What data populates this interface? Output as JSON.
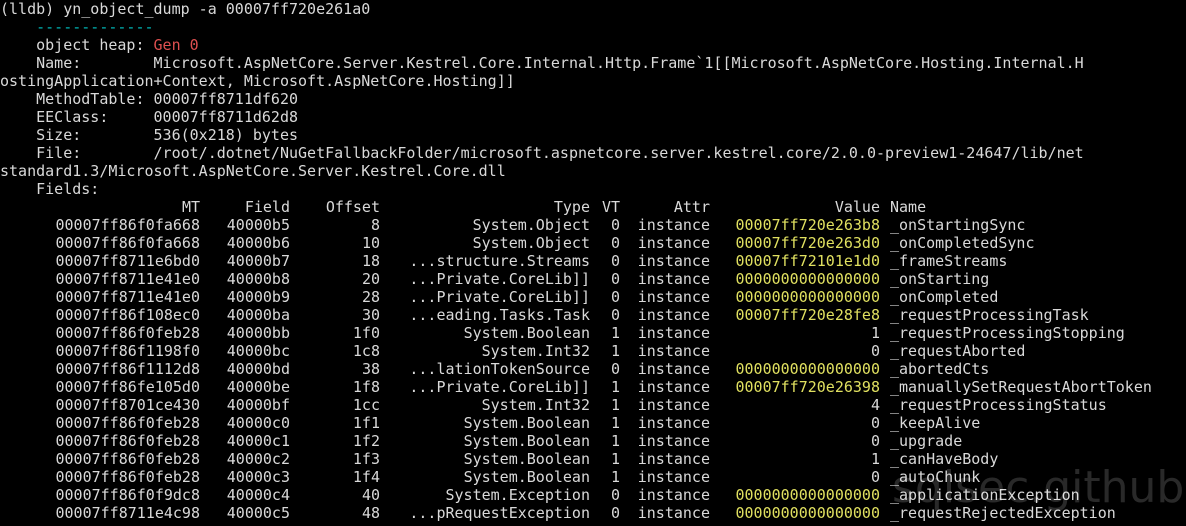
{
  "colors": {
    "background": "#000000",
    "text": "#d9d9d9",
    "separator": "#00b7b7",
    "gen": "#e05050",
    "address_highlight": "#e0e060"
  },
  "command": "(lldb) yn_object_dump -a 00007ff720e261a0",
  "separator": "    -------------",
  "object_heap": {
    "label": "    object heap: ",
    "value": "Gen 0"
  },
  "name_lines": [
    "    Name:        Microsoft.AspNetCore.Server.Kestrel.Core.Internal.Http.Frame`1[[Microsoft.AspNetCore.Hosting.Internal.H",
    "ostingApplication+Context, Microsoft.AspNetCore.Hosting]]"
  ],
  "method_table": "    MethodTable: 00007ff8711df620",
  "ee_class": "    EEClass:     00007ff8711d62d8",
  "size": "    Size:        536(0x218) bytes",
  "file_lines": [
    "    File:        /root/.dotnet/NuGetFallbackFolder/microsoft.aspnetcore.server.kestrel.core/2.0.0-preview1-24647/lib/net",
    "standard1.3/Microsoft.AspNetCore.Server.Kestrel.Core.dll"
  ],
  "fields_label": "    Fields:",
  "columns": {
    "mt": "MT",
    "field": "Field",
    "offset": "Offset",
    "type": "Type",
    "vt": "VT",
    "attr": "Attr",
    "value": "Value",
    "name": "Name"
  },
  "fields": [
    {
      "mt": "00007ff86f0fa668",
      "field": "40000b5",
      "offset": "8",
      "type": "System.Object",
      "vt": "0",
      "attr": "instance",
      "value": "00007ff720e263b8",
      "name": "_onStartingSync",
      "addr": true
    },
    {
      "mt": "00007ff86f0fa668",
      "field": "40000b6",
      "offset": "10",
      "type": "System.Object",
      "vt": "0",
      "attr": "instance",
      "value": "00007ff720e263d0",
      "name": "_onCompletedSync",
      "addr": true
    },
    {
      "mt": "00007ff8711e6bd0",
      "field": "40000b7",
      "offset": "18",
      "type": "...structure.Streams",
      "vt": "0",
      "attr": "instance",
      "value": "00007ff72101e1d0",
      "name": "_frameStreams",
      "addr": true
    },
    {
      "mt": "00007ff8711e41e0",
      "field": "40000b8",
      "offset": "20",
      "type": "...Private.CoreLib]]",
      "vt": "0",
      "attr": "instance",
      "value": "0000000000000000",
      "name": "_onStarting",
      "addr": true
    },
    {
      "mt": "00007ff8711e41e0",
      "field": "40000b9",
      "offset": "28",
      "type": "...Private.CoreLib]]",
      "vt": "0",
      "attr": "instance",
      "value": "0000000000000000",
      "name": "_onCompleted",
      "addr": true
    },
    {
      "mt": "00007ff86f108ec0",
      "field": "40000ba",
      "offset": "30",
      "type": "...eading.Tasks.Task",
      "vt": "0",
      "attr": "instance",
      "value": "00007ff720e28fe8",
      "name": "_requestProcessingTask",
      "addr": true
    },
    {
      "mt": "00007ff86f0feb28",
      "field": "40000bb",
      "offset": "1f0",
      "type": "System.Boolean",
      "vt": "1",
      "attr": "instance",
      "value": "1",
      "name": "_requestProcessingStopping",
      "addr": false
    },
    {
      "mt": "00007ff86f1198f0",
      "field": "40000bc",
      "offset": "1c8",
      "type": "System.Int32",
      "vt": "1",
      "attr": "instance",
      "value": "0",
      "name": "_requestAborted",
      "addr": false
    },
    {
      "mt": "00007ff86f1112d8",
      "field": "40000bd",
      "offset": "38",
      "type": "...lationTokenSource",
      "vt": "0",
      "attr": "instance",
      "value": "0000000000000000",
      "name": "_abortedCts",
      "addr": true
    },
    {
      "mt": "00007ff86fe105d0",
      "field": "40000be",
      "offset": "1f8",
      "type": "...Private.CoreLib]]",
      "vt": "1",
      "attr": "instance",
      "value": "00007ff720e26398",
      "name": "_manuallySetRequestAbortToken",
      "addr": true
    },
    {
      "mt": "00007ff8701ce430",
      "field": "40000bf",
      "offset": "1cc",
      "type": "System.Int32",
      "vt": "1",
      "attr": "instance",
      "value": "4",
      "name": "_requestProcessingStatus",
      "addr": false
    },
    {
      "mt": "00007ff86f0feb28",
      "field": "40000c0",
      "offset": "1f1",
      "type": "System.Boolean",
      "vt": "1",
      "attr": "instance",
      "value": "0",
      "name": "_keepAlive",
      "addr": false
    },
    {
      "mt": "00007ff86f0feb28",
      "field": "40000c1",
      "offset": "1f2",
      "type": "System.Boolean",
      "vt": "1",
      "attr": "instance",
      "value": "0",
      "name": "_upgrade",
      "addr": false
    },
    {
      "mt": "00007ff86f0feb28",
      "field": "40000c2",
      "offset": "1f3",
      "type": "System.Boolean",
      "vt": "1",
      "attr": "instance",
      "value": "1",
      "name": "_canHaveBody",
      "addr": false
    },
    {
      "mt": "00007ff86f0feb28",
      "field": "40000c3",
      "offset": "1f4",
      "type": "System.Boolean",
      "vt": "1",
      "attr": "instance",
      "value": "0",
      "name": "_autoChunk",
      "addr": false
    },
    {
      "mt": "00007ff86f0f9dc8",
      "field": "40000c4",
      "offset": "40",
      "type": "System.Exception",
      "vt": "0",
      "attr": "instance",
      "value": "0000000000000000",
      "name": "_applicationException",
      "addr": true
    },
    {
      "mt": "00007ff8711e4c98",
      "field": "40000c5",
      "offset": "48",
      "type": "...pRequestException",
      "vt": "0",
      "attr": "instance",
      "value": "0000000000000000",
      "name": "_requestRejectedException",
      "addr": true
    }
  ],
  "watermark": "sqlsec.github.io"
}
